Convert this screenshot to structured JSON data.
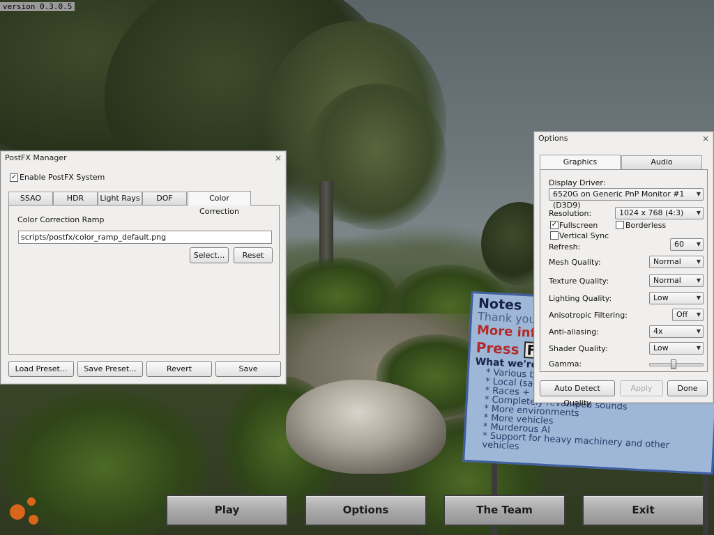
{
  "version_label": "version 0.3.0.5",
  "postfx": {
    "title": "PostFX Manager",
    "close_glyph": "×",
    "enable_label": "Enable PostFX System",
    "enable_checked": true,
    "tabs": [
      "SSAO",
      "HDR",
      "Light Rays",
      "DOF",
      "Color Correction"
    ],
    "active_tab": "Color Correction",
    "ramp_label": "Color Correction Ramp",
    "ramp_value": "scripts/postfx/color_ramp_default.png",
    "select_button": "Select...",
    "reset_button": "Reset",
    "load_preset": "Load Preset...",
    "save_preset": "Save Preset...",
    "revert": "Revert",
    "save": "Save"
  },
  "options": {
    "title": "Options",
    "close_glyph": "×",
    "tabs": [
      "Graphics",
      "Audio"
    ],
    "active_tab": "Graphics",
    "display_driver_label": "Display Driver:",
    "display_driver_value": "6520G on Generic PnP Monitor #1 (D3D9)",
    "resolution_label": "Resolution:",
    "resolution_value": "1024 x 768  (4:3)",
    "fullscreen_label": "Fullscreen",
    "fullscreen_checked": true,
    "borderless_label": "Borderless",
    "borderless_checked": false,
    "vsync_label": "Vertical Sync",
    "vsync_checked": false,
    "refresh_label": "Refresh:",
    "refresh_value": "60",
    "mesh_label": "Mesh Quality:",
    "mesh_value": "Normal",
    "texture_label": "Texture Quality:",
    "texture_value": "Normal",
    "lighting_label": "Lighting Quality:",
    "lighting_value": "Low",
    "aniso_label": "Anisotropic Filtering:",
    "aniso_value": "Off",
    "aa_label": "Anti-aliasing:",
    "aa_value": "4x",
    "shader_label": "Shader Quality:",
    "shader_value": "Low",
    "gamma_label": "Gamma:",
    "gamma_level": 0.45,
    "auto_detect": "Auto Detect Quality",
    "apply": "Apply",
    "done": "Done"
  },
  "sign": {
    "title": "Notes",
    "thanks": "Thank you",
    "more_info": "More inf",
    "press": "Press",
    "press_key": "F",
    "whats_new": "What we're",
    "items": [
      "Various bu",
      "Local (sam",
      "Races + va",
      "Completely revamped sounds",
      "More environments",
      "More vehicles",
      "Murderous AI",
      "Support for heavy machinery and other vehicles"
    ]
  },
  "main_menu": {
    "play": "Play",
    "options": "Options",
    "team": "The Team",
    "exit": "Exit"
  },
  "colors": {
    "sign_border": "#3e5ea0",
    "sign_bg": "#9fb7d6",
    "sign_red": "#b22a2a",
    "logo_orange": "#d9651c"
  }
}
